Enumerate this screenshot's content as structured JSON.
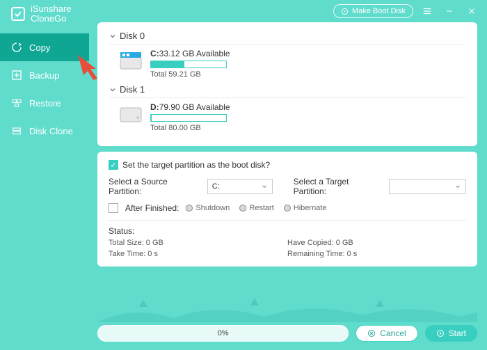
{
  "app": {
    "brand_line1": "iSunshare",
    "brand_line2": "CloneGo"
  },
  "titlebar": {
    "make_boot": "Make Boot Disk"
  },
  "sidebar": {
    "items": [
      {
        "label": "Copy"
      },
      {
        "label": "Backup"
      },
      {
        "label": "Restore"
      },
      {
        "label": "Disk Clone"
      }
    ]
  },
  "disks": [
    {
      "name": "Disk 0",
      "parts": [
        {
          "letter": "C:",
          "avail": "33.12 GB Available",
          "total": "Total 59.21 GB",
          "fill_pct": 44
        }
      ]
    },
    {
      "name": "Disk 1",
      "parts": [
        {
          "letter": "D:",
          "avail": "79.90 GB Available",
          "total": "Total 80.00 GB",
          "fill_pct": 1
        }
      ]
    }
  ],
  "options": {
    "boot_question": "Set the target partition as the boot disk?",
    "source_label": "Select a Source Partition:",
    "source_value": "C:",
    "target_label": "Select a Target Partition:",
    "target_value": "",
    "after_label": "After Finished:",
    "radios": {
      "shutdown": "Shutdown",
      "restart": "Restart",
      "hibernate": "Hibernate"
    }
  },
  "status": {
    "title": "Status:",
    "total_size": "Total Size: 0 GB",
    "have_copied": "Have Copied: 0 GB",
    "take_time": "Take Time: 0 s",
    "remaining": "Remaining Time: 0 s"
  },
  "footer": {
    "progress": "0%",
    "cancel": "Cancel",
    "start": "Start"
  }
}
